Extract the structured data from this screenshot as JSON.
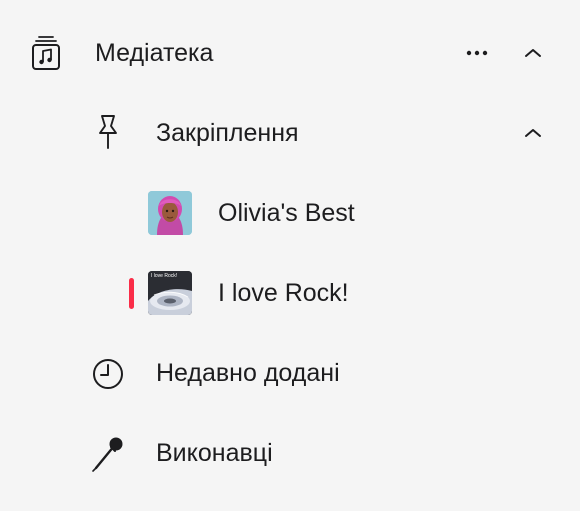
{
  "sidebar": {
    "library": {
      "label": "Медіатека",
      "icon": "music-library-icon",
      "more_icon": "more-ellipsis-icon",
      "collapse_icon": "chevron-up-icon"
    },
    "pinned": {
      "label": "Закріплення",
      "icon": "pin-icon",
      "collapse_icon": "chevron-up-icon",
      "items": [
        {
          "label": "Olivia's Best",
          "artwork": "memoji-avatar-artwork"
        },
        {
          "label": "I love Rock!",
          "artwork": "vinyl-record-artwork",
          "artwork_caption": "I love Rock!",
          "now_playing": true
        }
      ]
    },
    "recently_added": {
      "label": "Недавно додані",
      "icon": "clock-icon"
    },
    "artists": {
      "label": "Виконавці",
      "icon": "microphone-icon"
    }
  },
  "colors": {
    "background": "#f5f5f5",
    "text": "#1d1d1f",
    "accent": "#fa2d48"
  }
}
